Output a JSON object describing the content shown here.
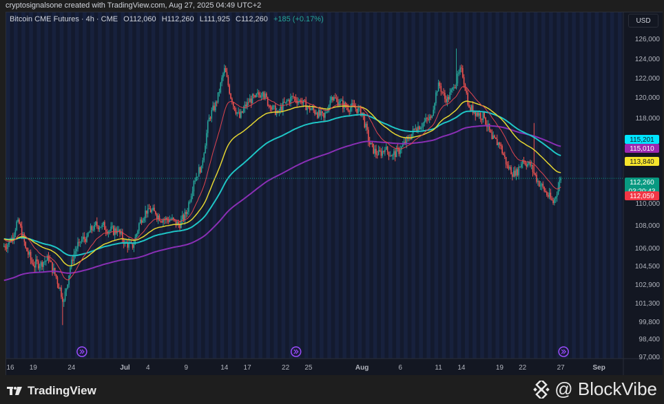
{
  "credit": "cryptosignalsone created with TradingView.com, Aug 27, 2025 04:49 UTC+2",
  "legend": {
    "symbol": "Bitcoin CME Futures · 4h · CME",
    "open": "O112,060",
    "high": "H112,260",
    "low": "L111,925",
    "close": "C112,260",
    "change": "+185 (+0.17%)"
  },
  "currency": "USD",
  "footer": {
    "brand": "TradingView",
    "watermark": "@ BlockVibe"
  },
  "colors": {
    "background": "#131a2e",
    "up": "#26a69a",
    "down": "#ef5350",
    "ma_red": "#e0444f",
    "ma_yellow": "#e5d632",
    "ma_cyan": "#1fc6c6",
    "ma_purple": "#8a2fb5"
  },
  "chart_data": {
    "type": "candlestick",
    "title": "Bitcoin CME Futures · 4h · CME",
    "y_ticks": [
      126000,
      124000,
      122000,
      120000,
      118000,
      110000,
      108000,
      106000,
      104500,
      102900,
      101300,
      99800,
      98400,
      97000
    ],
    "y_tick_labels": [
      "126,000",
      "124,000",
      "122,000",
      "120,000",
      "118,000",
      "110,000",
      "108,000",
      "106,000",
      "104,500",
      "102,900",
      "101,300",
      "99,800",
      "98,400",
      "97,000"
    ],
    "x_tick_labels": [
      "16",
      "19",
      "24",
      "Jul",
      "4",
      "9",
      "14",
      "17",
      "22",
      "25",
      "Aug",
      "6",
      "11",
      "14",
      "19",
      "22",
      "27",
      "Sep"
    ],
    "x_tick_days": [
      0,
      3,
      8,
      15,
      18,
      23,
      28,
      31,
      36,
      39,
      46,
      51,
      56,
      59,
      64,
      67,
      72,
      77
    ],
    "start_date": "Jun 16",
    "daily_close": [
      106500,
      108500,
      106000,
      104500,
      104800,
      105000,
      103500,
      101500,
      105000,
      106500,
      107000,
      108000,
      108000,
      107500,
      107500,
      106500,
      106000,
      108500,
      109500,
      109000,
      108500,
      108500,
      108000,
      109000,
      112000,
      113500,
      118000,
      119500,
      123000,
      119500,
      118000,
      119500,
      120000,
      120500,
      119000,
      118500,
      119500,
      120000,
      119500,
      119000,
      118500,
      118000,
      120000,
      119500,
      119000,
      119000,
      118500,
      115500,
      114500,
      115000,
      114500,
      115000,
      116000,
      117000,
      117500,
      118000,
      121500,
      119500,
      121000,
      123000,
      119000,
      118500,
      118000,
      116000,
      115500,
      113500,
      112500,
      114000,
      113500,
      112000,
      111000,
      110000,
      112260
    ],
    "notable_extremes": {
      "low": 99500,
      "high": 125000
    },
    "price_labels": [
      {
        "label": "115,201",
        "value": 115201,
        "series": "MA cyan",
        "color": "#00e5ff"
      },
      {
        "label": "115,010",
        "value": 115010,
        "series": "MA purple",
        "color": "#9c27b0"
      },
      {
        "label": "113,840",
        "value": 113840,
        "series": "MA yellow",
        "color": "#f5e52c"
      },
      {
        "label": "112,260",
        "value": 112260,
        "series": "Last price",
        "color": "#089981",
        "countdown": "03:20:43"
      },
      {
        "label": "112,059",
        "value": 112059,
        "series": "MA red",
        "color": "#f23645"
      }
    ],
    "events_days": [
      9,
      37,
      72
    ]
  }
}
